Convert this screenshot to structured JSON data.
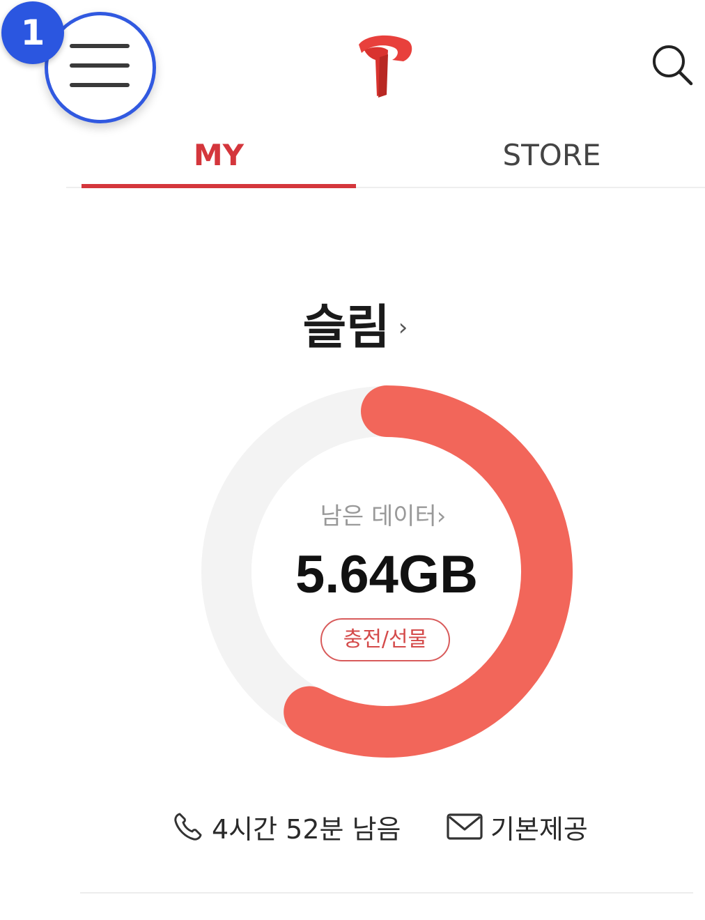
{
  "header": {
    "step_badge": "1",
    "logo_icon": "t-logo-icon",
    "menu_icon": "hamburger-menu-icon",
    "search_icon": "search-icon"
  },
  "tabs": [
    {
      "label": "MY",
      "active": true
    },
    {
      "label": "STORE",
      "active": false
    }
  ],
  "plan": {
    "name": "슬림",
    "chevron": "›"
  },
  "data_gauge": {
    "label": "남은 데이터",
    "label_chevron": "›",
    "value": "5.64GB",
    "remaining_fraction": 0.58,
    "recharge_label": "충전/선물"
  },
  "usage": {
    "call_text": "4시간 52분 남음",
    "call_icon": "phone-icon",
    "message_text": "기본제공",
    "message_icon": "envelope-icon"
  },
  "colors": {
    "accent": "#d4363c",
    "gauge_fill": "#f2665a",
    "gauge_track": "#f3f3f3",
    "badge": "#2b56e0"
  }
}
